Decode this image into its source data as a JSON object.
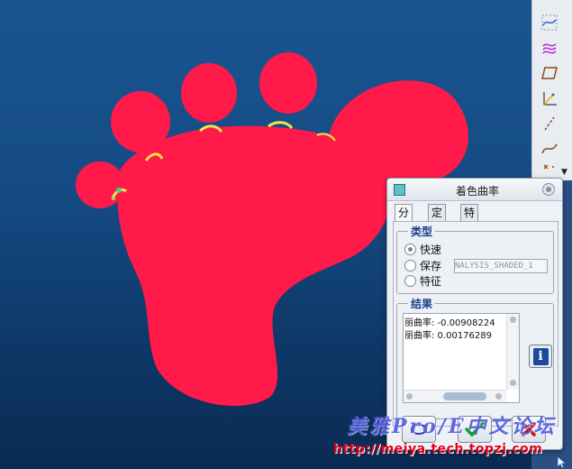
{
  "dialog": {
    "title": "着色曲率",
    "tabs": [
      {
        "label": "分析",
        "active": true
      },
      {
        "label": "定义",
        "active": false
      },
      {
        "label": "特征",
        "active": false
      }
    ],
    "type_group": {
      "title": "类型",
      "options": [
        {
          "label": "快速",
          "selected": true
        },
        {
          "label": "保存",
          "selected": false
        },
        {
          "label": "特征",
          "selected": false
        }
      ],
      "name_field_value": "NALYSIS_SHADED_1"
    },
    "results_group": {
      "title": "结果",
      "lines": [
        "丽曲率: -0.00908224",
        "丽曲率: 0.00176289"
      ]
    }
  },
  "watermark": {
    "brand": "美雅Pro/E中文论坛",
    "url": "http://meiya.tech.topzj.com"
  },
  "colors": {
    "model": "#ff1a4a",
    "viewport_top": "#1a5591",
    "viewport_bottom": "#0a2a52",
    "accent_title": "#1d3f8c"
  },
  "icons": [
    "curve-sketch-icon",
    "surface-curves-icon",
    "datum-plane-icon",
    "datum-axis-icon",
    "dashed-axis-icon",
    "spline-icon",
    "point-icon"
  ]
}
